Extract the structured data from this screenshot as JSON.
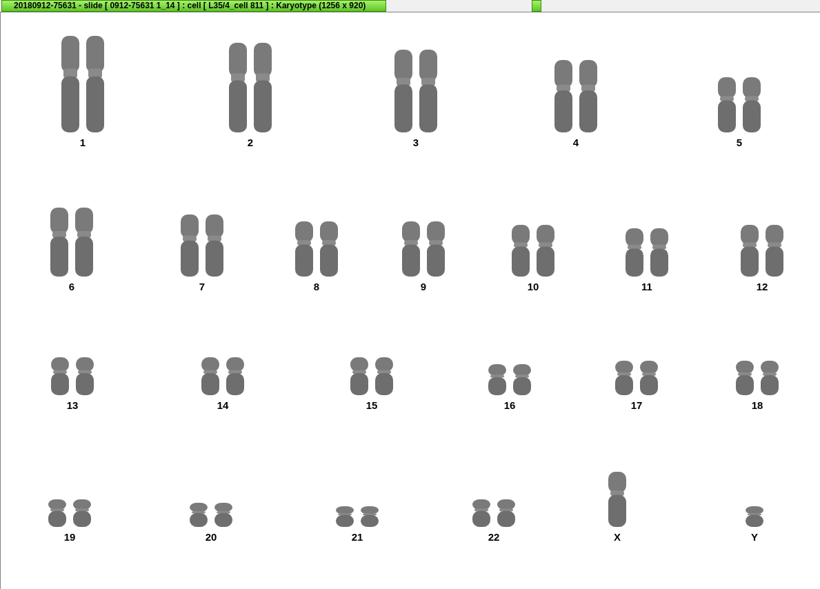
{
  "window": {
    "title": "20180912-75631 - slide [ 0912-75631 1_14 ] : cell [ L35/4_cell 811 ] : Karyotype  (1256 x 920)"
  },
  "karyotype": {
    "rows": [
      {
        "chromosomes": [
          {
            "label": "1"
          },
          {
            "label": "2"
          },
          {
            "label": "3"
          },
          {
            "label": "4"
          },
          {
            "label": "5"
          }
        ]
      },
      {
        "chromosomes": [
          {
            "label": "6"
          },
          {
            "label": "7"
          },
          {
            "label": "8"
          },
          {
            "label": "9"
          },
          {
            "label": "10"
          },
          {
            "label": "11"
          },
          {
            "label": "12"
          }
        ]
      },
      {
        "chromosomes": [
          {
            "label": "13"
          },
          {
            "label": "14"
          },
          {
            "label": "15"
          },
          {
            "label": "16"
          },
          {
            "label": "17"
          },
          {
            "label": "18"
          }
        ]
      },
      {
        "chromosomes": [
          {
            "label": "19"
          },
          {
            "label": "20"
          },
          {
            "label": "21"
          },
          {
            "label": "22"
          },
          {
            "label": "X"
          },
          {
            "label": "Y"
          }
        ]
      }
    ]
  }
}
